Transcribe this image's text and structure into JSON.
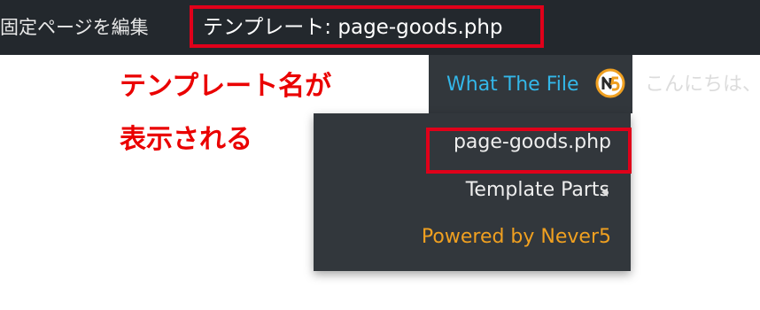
{
  "adminbar": {
    "edit_page_label": "固定ページを編集",
    "template_label": "テンプレート: page-goods.php",
    "what_the_file_label": "What The File",
    "greeting": "こんにちは、"
  },
  "submenu": {
    "file_name": "page-goods.php",
    "template_parts_label": "Template Parts",
    "powered_by_label": "Powered by Never5"
  },
  "annotation": {
    "line1": "テンプレート名が",
    "line2": "表示される"
  },
  "icons": {
    "never5_logo": "never5-logo-icon",
    "submenu_arrow": "arrow-left-icon"
  },
  "colors": {
    "adminbar_bg": "#23282d",
    "submenu_bg": "#32373c",
    "highlight_red": "#e0001a",
    "link_blue": "#33b7e9",
    "powered_orange": "#f0a020"
  }
}
